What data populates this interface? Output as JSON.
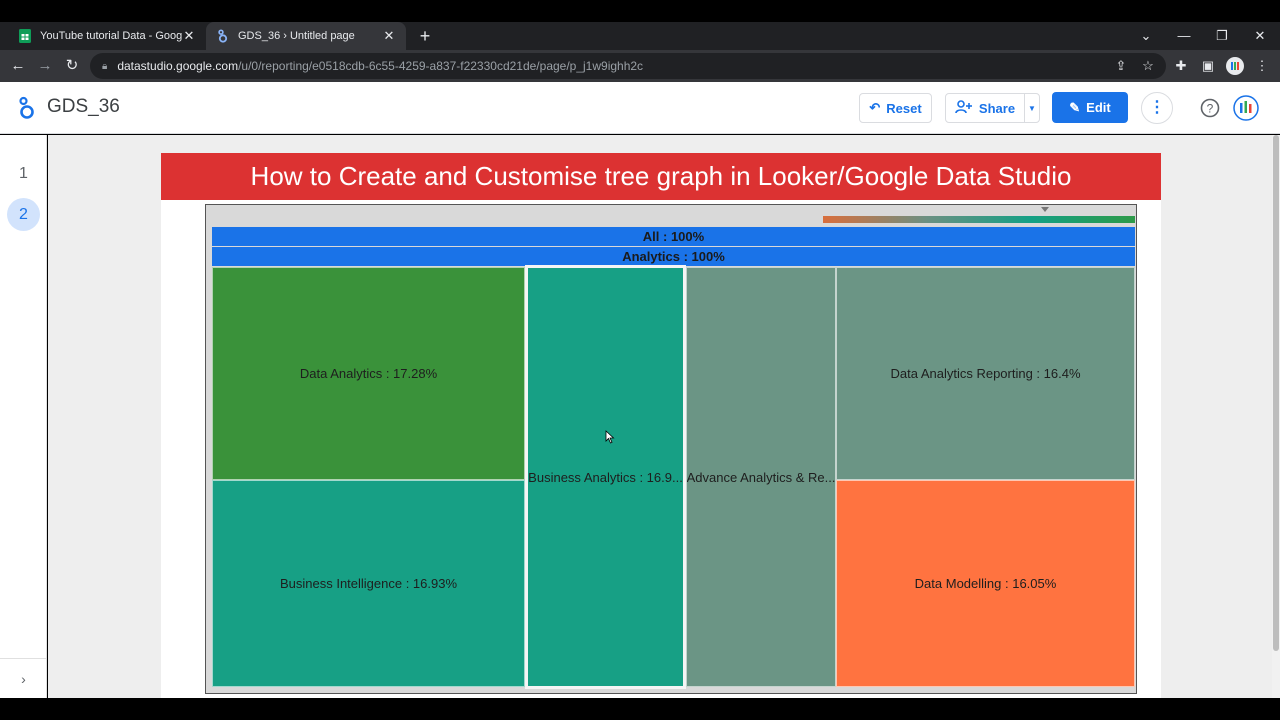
{
  "browser": {
    "tabs": [
      {
        "title": "YouTube tutorial Data - Google S",
        "active": false
      },
      {
        "title": "GDS_36 › Untitled page",
        "active": true
      }
    ],
    "url_host": "datastudio.google.com",
    "url_path": "/u/0/reporting/e0518cdb-6c55-4259-a837-f22330cd21de/page/p_j1w9ighh2c"
  },
  "app": {
    "title": "GDS_36",
    "reset_label": "Reset",
    "share_label": "Share",
    "edit_label": "Edit"
  },
  "pages": [
    "1",
    "2"
  ],
  "active_page": "2",
  "report": {
    "banner": "How to Create and Customise tree graph in Looker/Google Data Studio"
  },
  "chart_data": {
    "type": "treemap",
    "root": {
      "label": "All : 100%",
      "value": 100
    },
    "level1": {
      "label": "Analytics : 100%",
      "value": 100
    },
    "leaves": [
      {
        "name": "Data Analytics",
        "label": "Data Analytics : 17.28%",
        "value": 17.28,
        "color": "#3a923a"
      },
      {
        "name": "Business Intelligence",
        "label": "Business Intelligence : 16.93%",
        "value": 16.93,
        "color": "#17a085"
      },
      {
        "name": "Business Analytics",
        "label": "Business Analytics : 16.9...",
        "value": 16.9,
        "color": "#17a085"
      },
      {
        "name": "Advance Analytics & Re...",
        "label": "Advance Analytics & Re...",
        "color": "#6b9585"
      },
      {
        "name": "Data Analytics Reporting",
        "label": "Data Analytics Reporting : 16.4%",
        "value": 16.4,
        "color": "#6b9585"
      },
      {
        "name": "Data Modelling",
        "label": "Data Modelling : 16.05%",
        "value": 16.05,
        "color": "#ff7340"
      }
    ]
  }
}
